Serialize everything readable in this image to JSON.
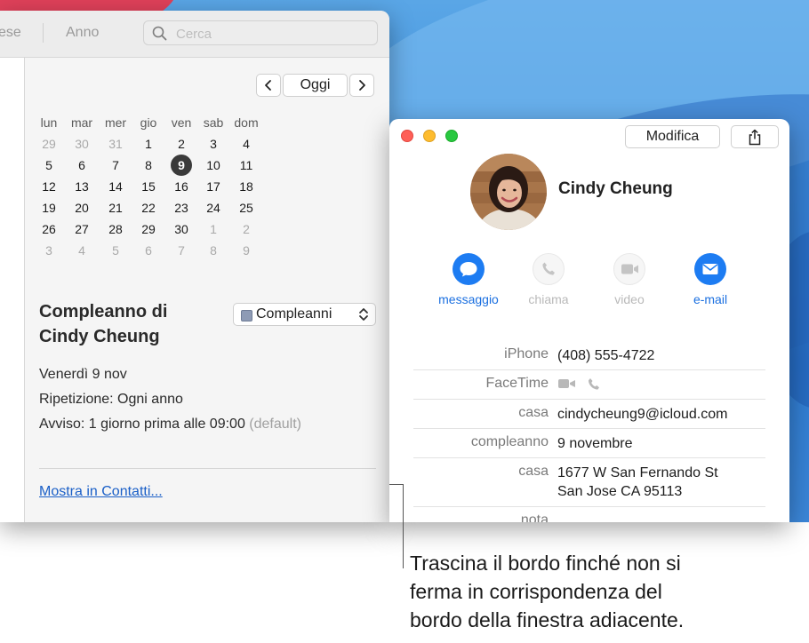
{
  "calendar": {
    "toolbar": {
      "month_partial": "ese",
      "year_label": "Anno",
      "search_placeholder": "Cerca"
    },
    "nav": {
      "today": "Oggi"
    },
    "weekdays": [
      "lun",
      "mar",
      "mer",
      "gio",
      "ven",
      "sab",
      "dom"
    ],
    "weeks": [
      [
        "29",
        "30",
        "31",
        "1",
        "2",
        "3",
        "4"
      ],
      [
        "5",
        "6",
        "7",
        "8",
        "9",
        "10",
        "11"
      ],
      [
        "12",
        "13",
        "14",
        "15",
        "16",
        "17",
        "18"
      ],
      [
        "19",
        "20",
        "21",
        "22",
        "23",
        "24",
        "25"
      ],
      [
        "26",
        "27",
        "28",
        "29",
        "30",
        "1",
        "2"
      ],
      [
        "3",
        "4",
        "5",
        "6",
        "7",
        "8",
        "9"
      ]
    ],
    "event": {
      "title_line1": "Compleanno di",
      "title_line2": "Cindy Cheung",
      "calendar_name": "Compleanni",
      "calendar_color": "#8e9bb5",
      "date": "Venerdì 9 nov",
      "repeat": "Ripetizione: Ogni anno",
      "alert": "Avviso: 1 giorno prima alle 09:00",
      "alert_default": "(default)",
      "link": "Mostra in Contatti..."
    }
  },
  "contacts": {
    "edit_label": "Modifica",
    "name": "Cindy Cheung",
    "actions": [
      {
        "label": "messaggio",
        "icon": "message-bubble-icon",
        "enabled": true
      },
      {
        "label": "chiama",
        "icon": "phone-icon",
        "enabled": false
      },
      {
        "label": "video",
        "icon": "video-camera-icon",
        "enabled": false
      },
      {
        "label": "e-mail",
        "icon": "envelope-icon",
        "enabled": true
      }
    ],
    "fields": [
      {
        "label": "iPhone",
        "value": "(408) 555-4722"
      },
      {
        "label": "FaceTime",
        "value": ""
      },
      {
        "label": "casa",
        "value": "cindycheung9@icloud.com"
      },
      {
        "label": "compleanno",
        "value": "9 novembre"
      },
      {
        "label": "casa",
        "value": "1677 W San Fernando St",
        "value2": "San Jose CA 95113"
      },
      {
        "label": "nota",
        "value": ""
      }
    ],
    "accent_color": "#1d7cf2"
  },
  "callout": {
    "line1": "Trascina il bordo finché non si",
    "line2": "ferma in corrispondenza del",
    "line3": "bordo della finestra adiacente."
  }
}
